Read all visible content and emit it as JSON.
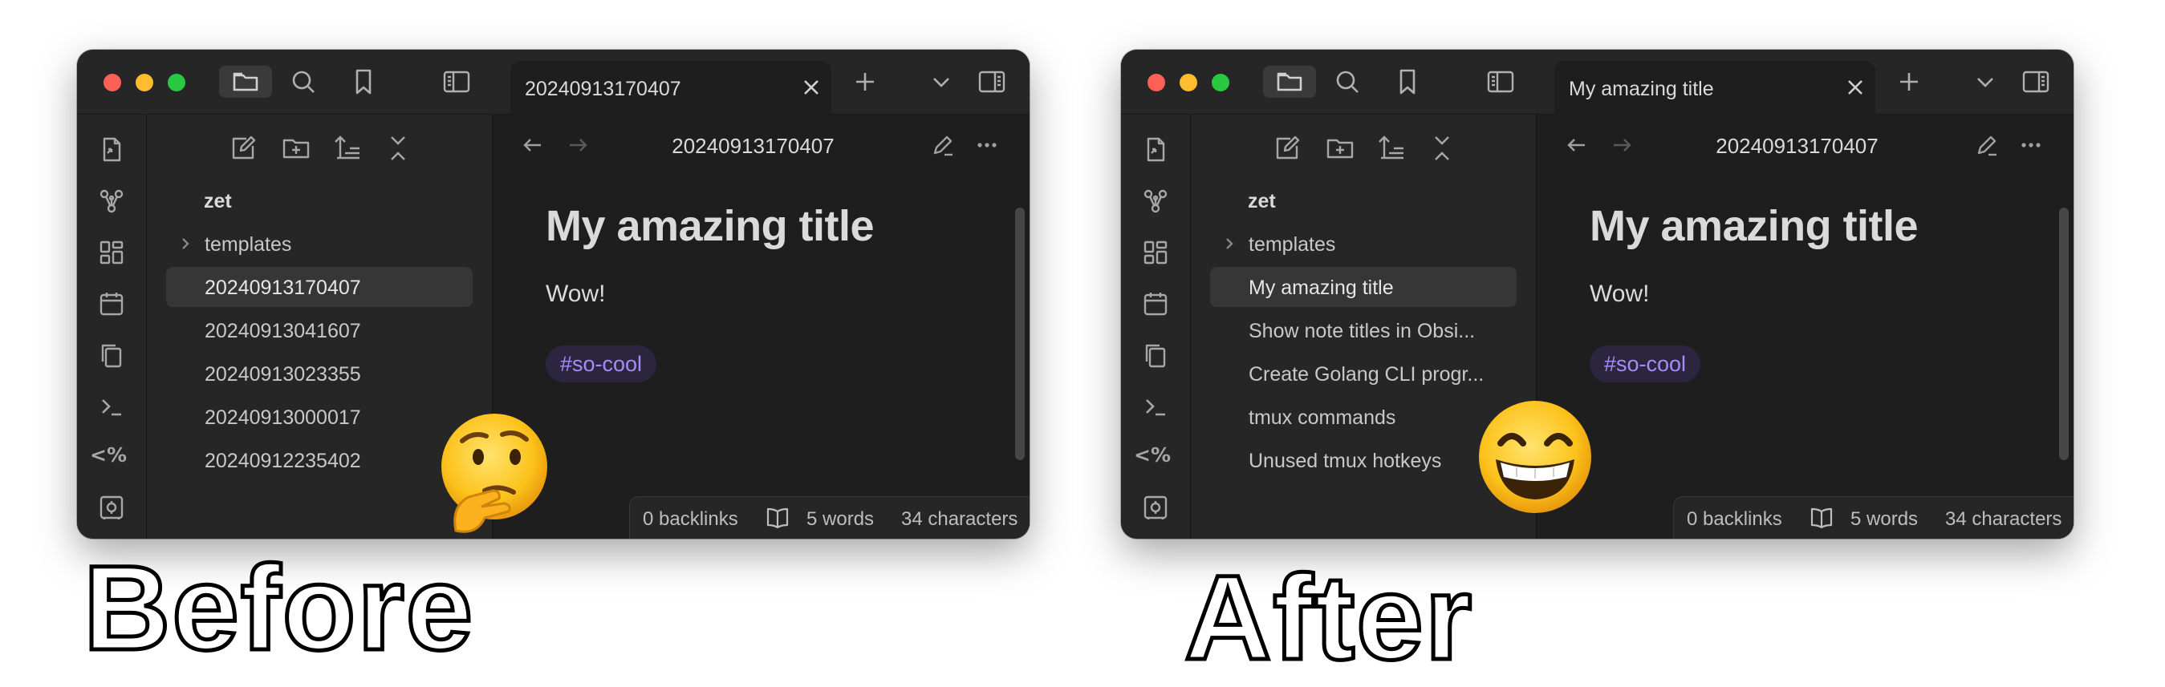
{
  "before": {
    "tab_title": "20240913170407",
    "view_title": "20240913170407",
    "vault": "zet",
    "folder": "templates",
    "files": [
      "20240913170407",
      "20240913041607",
      "20240913023355",
      "20240913000017",
      "20240912235402"
    ],
    "selected_index": 0,
    "doc": {
      "title": "My amazing title",
      "body": "Wow!",
      "tag": "#so-cool"
    },
    "status": {
      "backlinks": "0 backlinks",
      "words": "5 words",
      "characters": "34 characters"
    },
    "caption": "Before",
    "emoji": "thinking-face"
  },
  "after": {
    "tab_title": "My amazing title",
    "view_title": "20240913170407",
    "vault": "zet",
    "folder": "templates",
    "files": [
      "My amazing title",
      "Show note titles in Obsi...",
      "Create Golang CLI progr...",
      "tmux commands",
      "Unused tmux hotkeys"
    ],
    "selected_index": 0,
    "doc": {
      "title": "My amazing title",
      "body": "Wow!",
      "tag": "#so-cool"
    },
    "status": {
      "backlinks": "0 backlinks",
      "words": "5 words",
      "characters": "34 characters"
    },
    "caption": "After",
    "emoji": "grinning-face-with-smiling-eyes"
  },
  "ribbon": {
    "template_symbol": "<%",
    "icons": [
      "open-note-icon",
      "graph-icon",
      "canvas-icon",
      "calendar-icon",
      "copy-icon",
      "terminal-icon",
      "templater-icon",
      "vault-icon"
    ]
  },
  "titlebar_icons": [
    "folder-icon",
    "search-icon",
    "bookmark-icon",
    "sidebar-toggle-icon",
    "new-tab-icon",
    "tab-list-icon",
    "right-sidebar-icon"
  ],
  "colors": {
    "accent": "#a88bfa",
    "tag_bg": "#2c2540",
    "window_bg": "#1e1e1e",
    "panel_bg": "#262626"
  }
}
